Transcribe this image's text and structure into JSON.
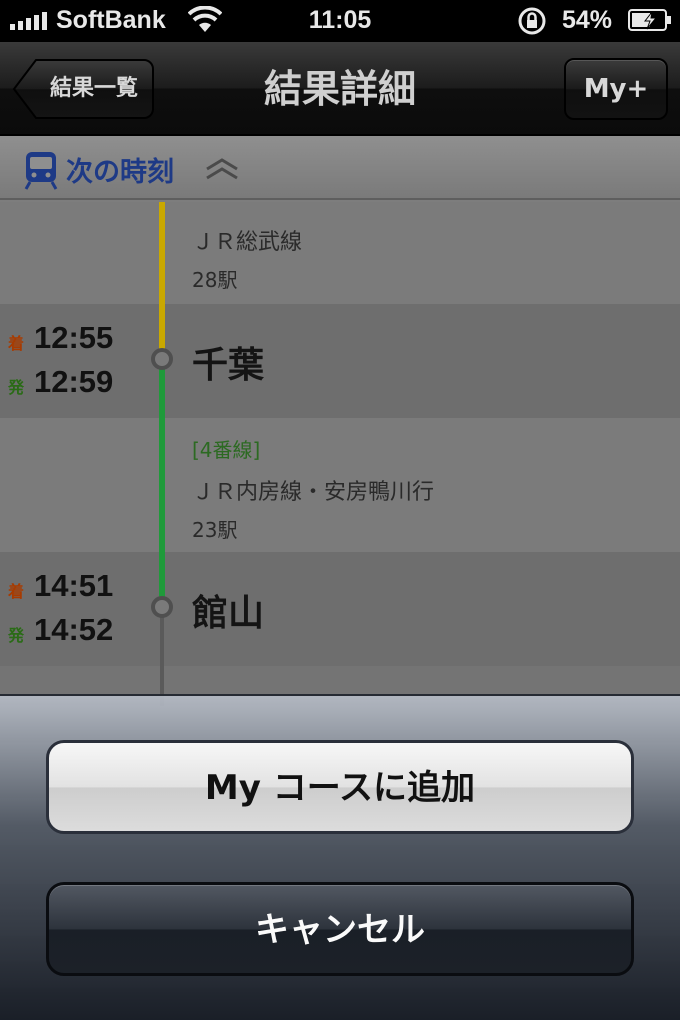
{
  "status_bar": {
    "carrier": "SoftBank",
    "time": "11:05",
    "battery": "54%"
  },
  "nav": {
    "back_label": "結果一覧",
    "title": "結果詳細",
    "right_button": "My+"
  },
  "next_bar": {
    "label": "次の時刻"
  },
  "route": {
    "segment1": {
      "line": "ＪＲ総武線",
      "stations": "28駅"
    },
    "station1": {
      "name": "千葉",
      "arr_mark": "着",
      "arr_time": "12:55",
      "dep_mark": "発",
      "dep_time": "12:59"
    },
    "segment2": {
      "track": "[4番線]",
      "line": "ＪＲ内房線・安房鴨川行",
      "stations": "23駅"
    },
    "station2": {
      "name": "館山",
      "arr_mark": "着",
      "arr_time": "14:51",
      "dep_mark": "発",
      "dep_time": "14:52"
    }
  },
  "action_sheet": {
    "add_label": "My コースに追加",
    "cancel_label": "キャンセル"
  },
  "colors": {
    "line_sobu": "#c9a800",
    "line_uchibo": "#1f9a3a",
    "next_bar_text": "#1e3a86"
  }
}
